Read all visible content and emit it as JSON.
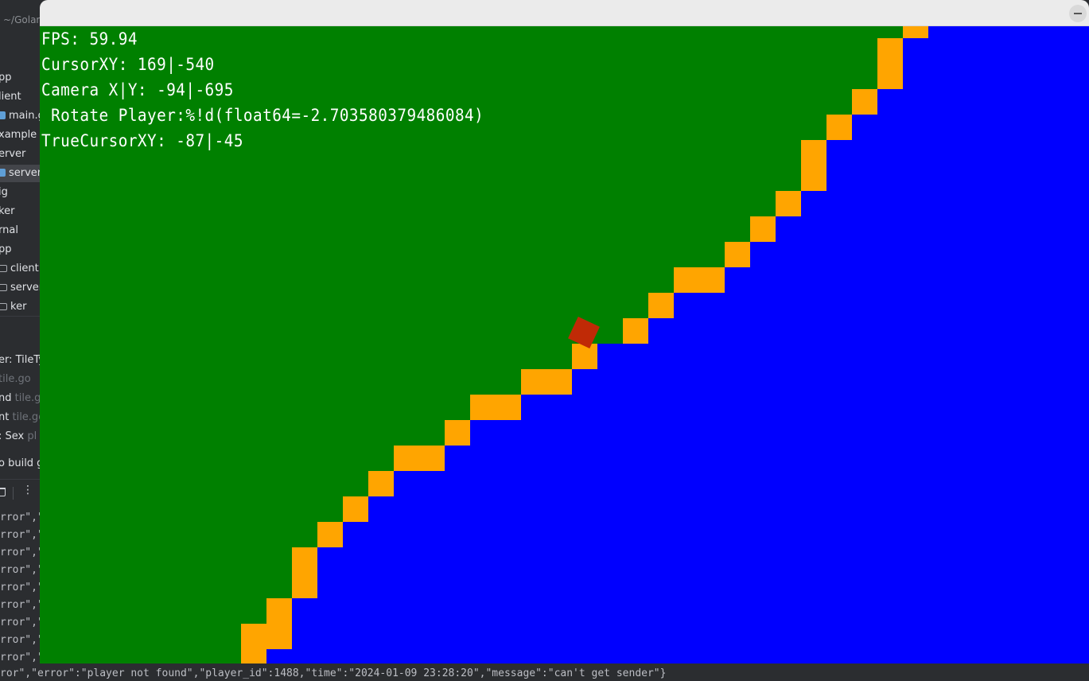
{
  "ide": {
    "project_path": "~/Golar",
    "tree": [
      {
        "label": "pp",
        "icon": "",
        "selected": false
      },
      {
        "label": "lient",
        "icon": "",
        "selected": false
      },
      {
        "label": "main.g",
        "icon": "go-file-icon",
        "selected": false
      },
      {
        "label": "xample",
        "icon": "",
        "selected": false
      },
      {
        "label": "erver",
        "icon": "",
        "selected": false
      },
      {
        "label": "server",
        "icon": "go-file-icon",
        "selected": true
      },
      {
        "label": "ig",
        "icon": "",
        "selected": false
      },
      {
        "label": "ker",
        "icon": "",
        "selected": false
      },
      {
        "label": "rnal",
        "icon": "",
        "selected": false
      },
      {
        "label": "pp",
        "icon": "",
        "selected": false
      },
      {
        "label": "client",
        "icon": "folder-icon",
        "selected": false
      },
      {
        "label": "server",
        "icon": "folder-icon",
        "selected": false
      },
      {
        "label": "ker",
        "icon": "folder-icon",
        "selected": false
      }
    ],
    "structure": [
      {
        "label": "er: TileTy",
        "hint": ""
      },
      {
        "label": "",
        "hint": "tile.go"
      },
      {
        "label": "nd",
        "hint": "tile.g"
      },
      {
        "label": "nt",
        "hint": "tile.go"
      },
      {
        "label": ": Sex",
        "hint": "pl"
      }
    ],
    "run_config": "o build gi",
    "log_lines": [
      "rror\",\"",
      "rror\",\"",
      "rror\",\"",
      "rror\",\"",
      "rror\",\"",
      "rror\",\"",
      "rror\",\"",
      "rror\",\"",
      "rror\",\""
    ],
    "log_bottom": "ror\",\"error\":\"player not found\",\"player_id\":1488,\"time\":\"2024-01-09 23:28:20\",\"message\":\"can't get sender\"}",
    "toolbar_icons": [
      "trash-icon",
      "more-vertical-icon"
    ]
  },
  "game": {
    "hud": [
      "FPS: 59.94",
      "CursorXY: 169|-540",
      "Camera X|Y: -94|-695",
      " Rotate Player:%!d(float64=-2.703580379486084)",
      "TrueCursorXY: -87|-45"
    ],
    "colors": {
      "grass": "#008000",
      "water": "#0000ff",
      "sand": "#ffa500",
      "player": "#c02a06"
    },
    "player_rotation_rad": -2.703580379486084
  }
}
